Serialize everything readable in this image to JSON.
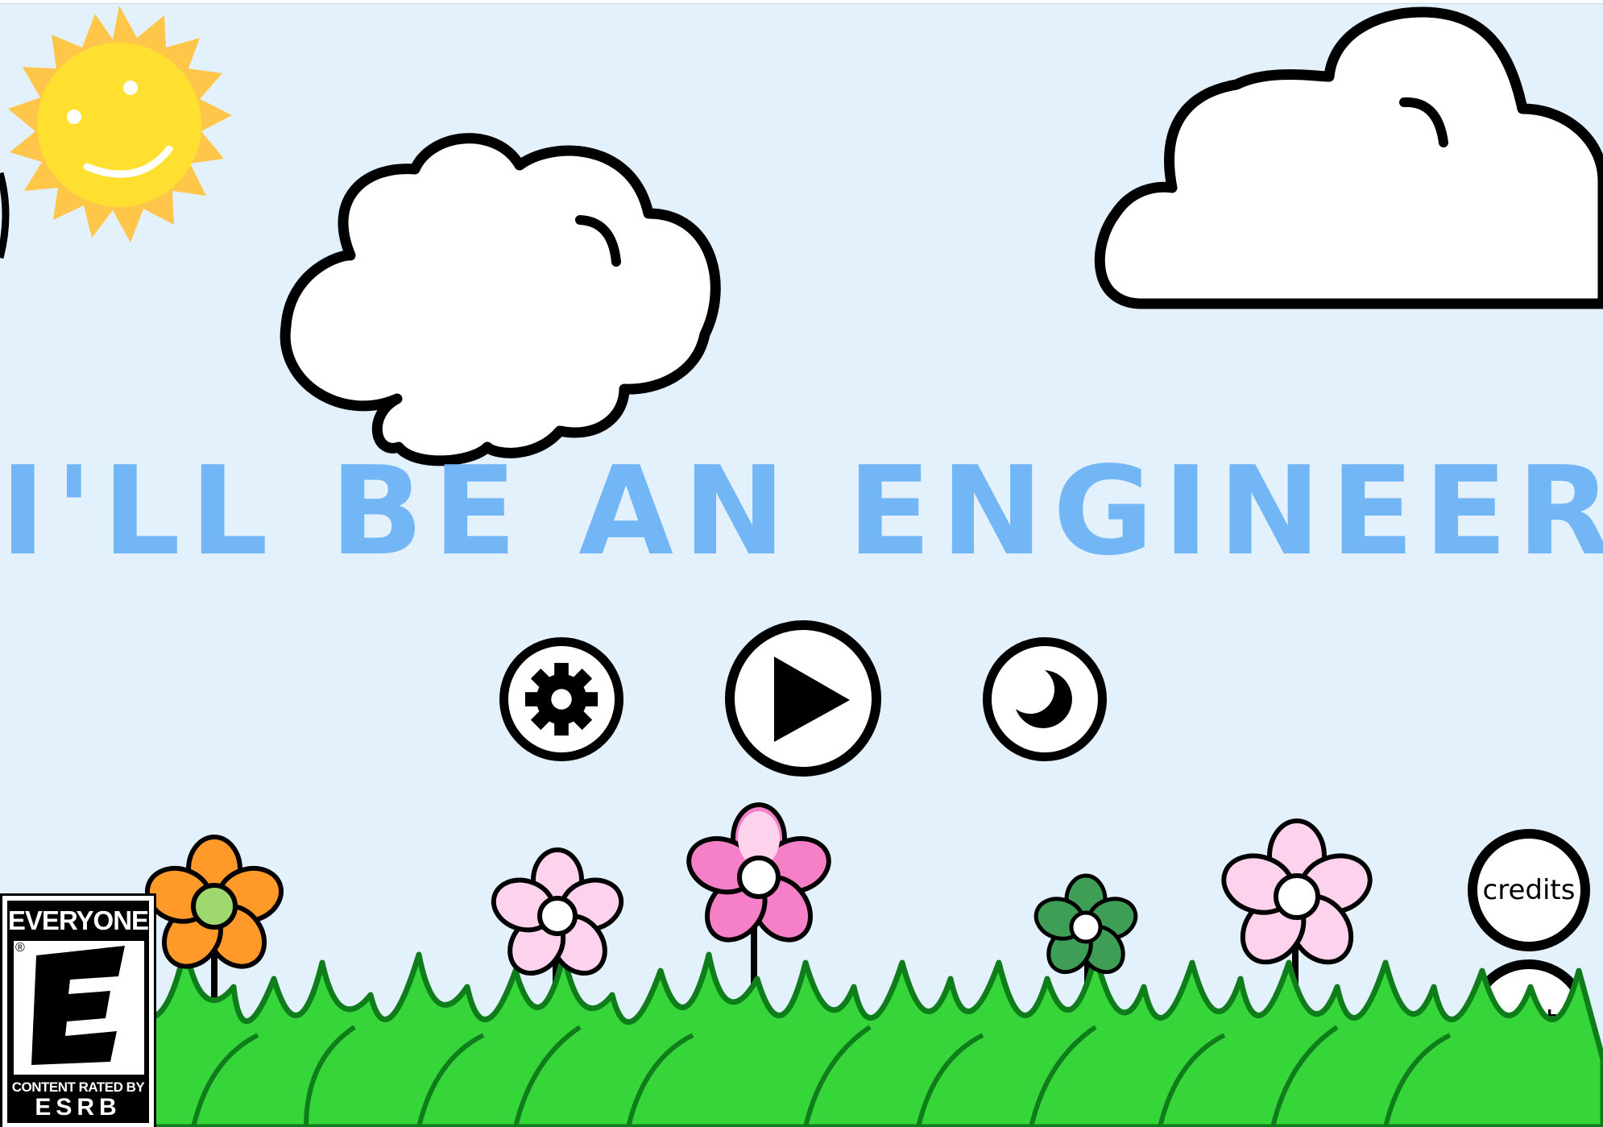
{
  "title": "I'LL BE AN ENGINEER",
  "menu": {
    "settings_icon": "gear-icon",
    "play_icon": "play-icon",
    "night_mode_icon": "moon-icon",
    "credits_label": "credits",
    "exit_label": "exit"
  },
  "esrb": {
    "rating": "EVERYONE",
    "letter": "E",
    "content_rated_by": "CONTENT RATED BY",
    "brand": "ESRB"
  },
  "colors": {
    "sky": "#e3f1fd",
    "title": "#6cb3f6",
    "grass": "#36d63a",
    "sun": "#ffe030",
    "sun_rays": "#ffc64a"
  }
}
